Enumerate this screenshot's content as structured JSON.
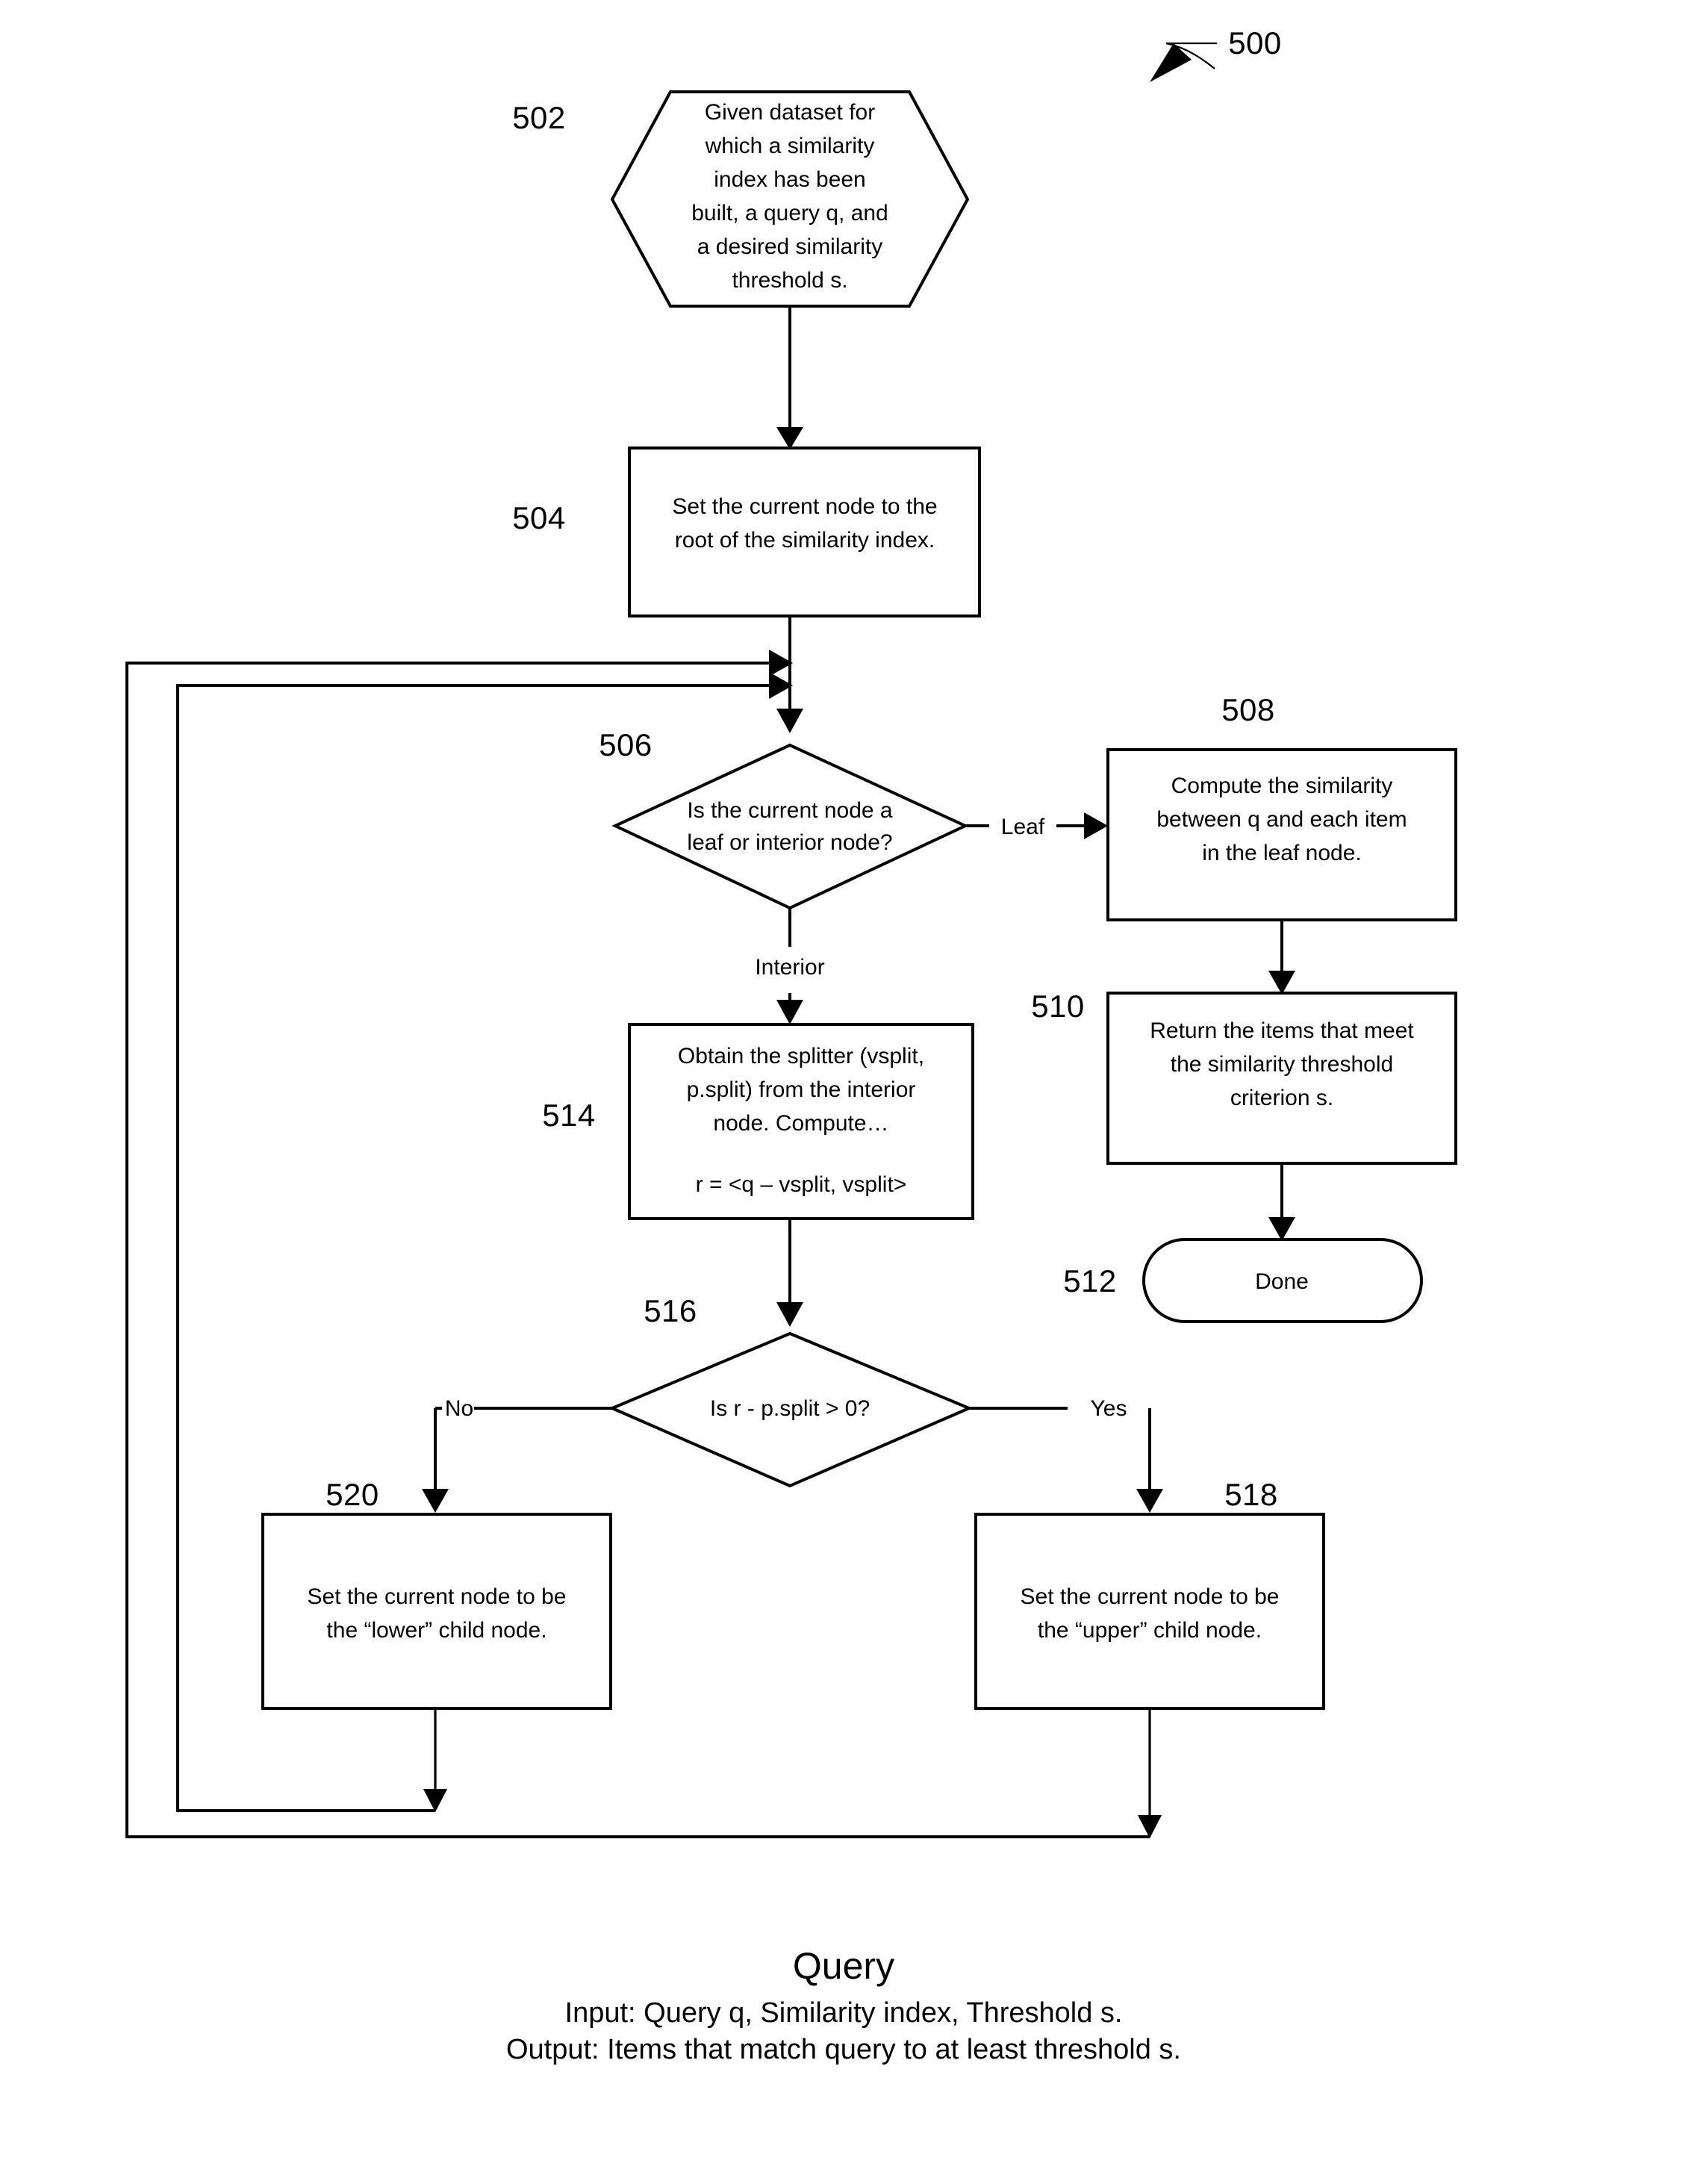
{
  "figure": {
    "ref_number": "500",
    "caption_title": "Query",
    "caption_input": "Input: Query q, Similarity index, Threshold s.",
    "caption_output": "Output: Items that match query to at least threshold s."
  },
  "nodes": {
    "start": {
      "ref": "502",
      "shape": "hexagon",
      "lines": [
        "Given dataset for",
        "which a similarity",
        "index has been",
        "built, a query q, and",
        "a desired similarity",
        "threshold s."
      ]
    },
    "set_root": {
      "ref": "504",
      "shape": "rect",
      "lines": [
        "Set the current node to the",
        "root of the similarity index."
      ]
    },
    "leaf_or_interior": {
      "ref": "506",
      "shape": "diamond",
      "lines": [
        "Is the current node a",
        "leaf or interior node?"
      ]
    },
    "compute_similarity": {
      "ref": "508",
      "shape": "rect",
      "lines": [
        "Compute the similarity",
        "between q and each item",
        "in the leaf node."
      ]
    },
    "return_items": {
      "ref": "510",
      "shape": "rect",
      "lines": [
        "Return the items that meet",
        "the similarity threshold",
        "criterion s."
      ]
    },
    "done": {
      "ref": "512",
      "shape": "rounded",
      "lines": [
        "Done"
      ]
    },
    "obtain_splitter": {
      "ref": "514",
      "shape": "rect",
      "lines": [
        "Obtain the splitter (vsplit,",
        "p.split) from the interior",
        "node.  Compute…"
      ],
      "formula": "r = <q – vsplit, vsplit>"
    },
    "compare_split": {
      "ref": "516",
      "shape": "diamond",
      "lines": [
        "Is r - p.split > 0?"
      ]
    },
    "upper_child": {
      "ref": "518",
      "shape": "rect",
      "lines": [
        "Set the current node to be",
        "the “upper” child node."
      ]
    },
    "lower_child": {
      "ref": "520",
      "shape": "rect",
      "lines": [
        "Set the current node to be",
        "the “lower” child node."
      ]
    }
  },
  "edge_labels": {
    "leaf": "Leaf",
    "interior": "Interior",
    "yes": "Yes",
    "no": "No"
  },
  "colors": {
    "stroke": "#000000",
    "fill": "#ffffff",
    "text": "#000000"
  }
}
